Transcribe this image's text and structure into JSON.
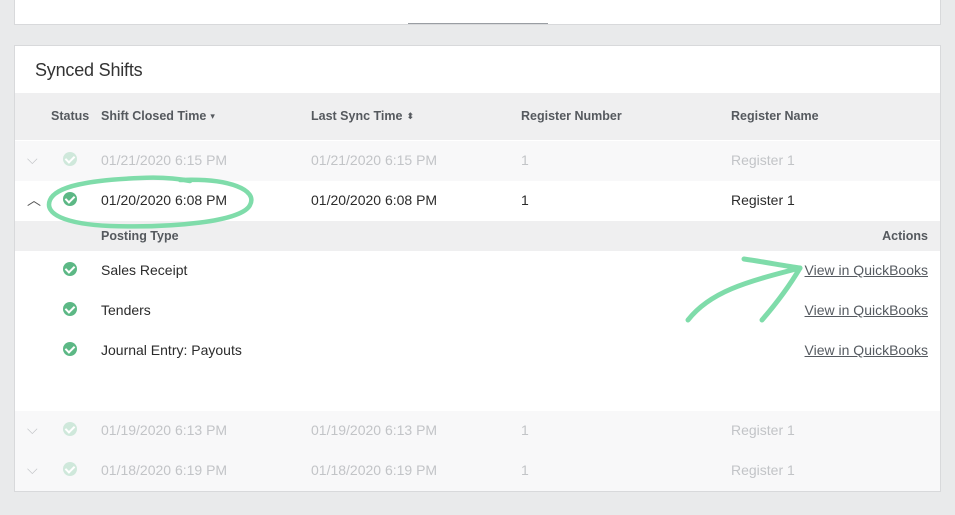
{
  "section": {
    "title": "Synced Shifts"
  },
  "table": {
    "headers": {
      "status": "Status",
      "shift_closed": "Shift Closed Time",
      "last_sync": "Last Sync Time",
      "register_number": "Register Number",
      "register_name": "Register Name"
    },
    "rows": [
      {
        "closed": "01/21/2020 6:15 PM",
        "synced": "01/21/2020 6:15 PM",
        "number": "1",
        "name": "Register 1"
      },
      {
        "closed": "01/20/2020 6:08 PM",
        "synced": "01/20/2020 6:08 PM",
        "number": "1",
        "name": "Register 1"
      },
      {
        "closed": "01/19/2020 6:13 PM",
        "synced": "01/19/2020 6:13 PM",
        "number": "1",
        "name": "Register 1"
      },
      {
        "closed": "01/18/2020 6:19 PM",
        "synced": "01/18/2020 6:19 PM",
        "number": "1",
        "name": "Register 1"
      }
    ]
  },
  "details": {
    "headers": {
      "posting_type": "Posting Type",
      "actions": "Actions"
    },
    "items": [
      {
        "type": "Sales Receipt",
        "action": "View in QuickBooks"
      },
      {
        "type": "Tenders",
        "action": "View in QuickBooks"
      },
      {
        "type": "Journal Entry: Payouts",
        "action": "View in QuickBooks"
      }
    ]
  },
  "colors": {
    "success": "#5cb885",
    "annotation": "#7fdcaa"
  },
  "icons": {
    "collapsed": "chevron-down-icon",
    "expanded": "chevron-up-icon",
    "status": "check-circle-icon",
    "sort": "sort-icon"
  }
}
